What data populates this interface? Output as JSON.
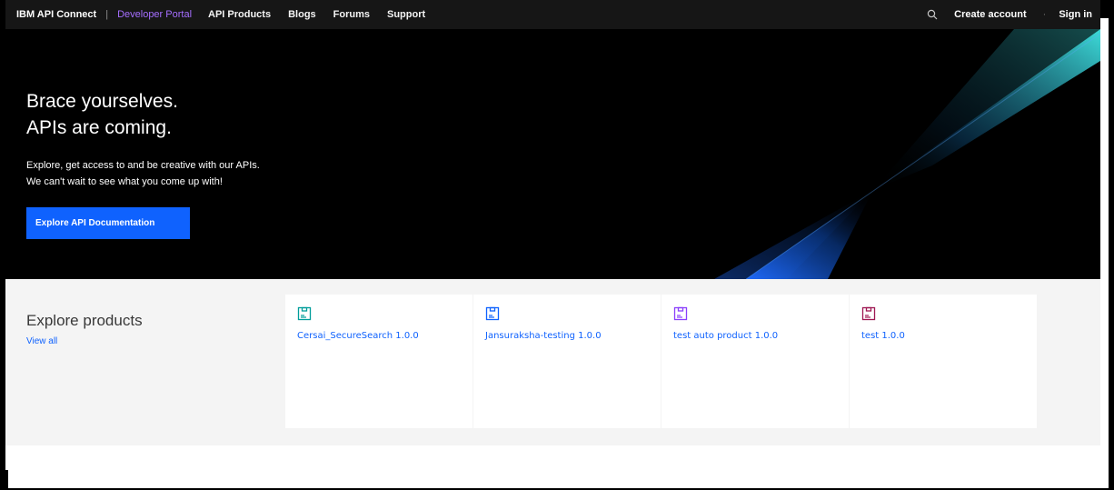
{
  "header": {
    "brand": "IBM API Connect",
    "separator": "|",
    "portal": "Developer Portal",
    "nav": [
      "API Products",
      "Blogs",
      "Forums",
      "Support"
    ],
    "create_account": "Create account",
    "dot": "·",
    "sign_in": "Sign in"
  },
  "hero": {
    "title_line1": "Brace yourselves.",
    "title_line2": "APIs are coming.",
    "subtitle_line1": "Explore, get access to and be creative with our APIs.",
    "subtitle_line2": "We can't wait to see what you come up with!",
    "cta": "Explore API Documentation"
  },
  "products": {
    "heading": "Explore products",
    "view_all": "View all",
    "items": [
      {
        "label": "Cersai_SecureSearch 1.0.0",
        "icon": "product-box-icon",
        "color": "#009d9a"
      },
      {
        "label": "Jansuraksha-testing 1.0.0",
        "icon": "product-box-icon",
        "color": "#0f62fe"
      },
      {
        "label": "test auto product 1.0.0",
        "icon": "product-box-icon",
        "color": "#8a3ffc"
      },
      {
        "label": "test 1.0.0",
        "icon": "product-box-icon",
        "color": "#9f1853"
      }
    ]
  },
  "colors": {
    "header_bg": "#161616",
    "portal_accent": "#a56eff",
    "primary": "#0f62fe",
    "section_bg": "#f4f4f4"
  }
}
